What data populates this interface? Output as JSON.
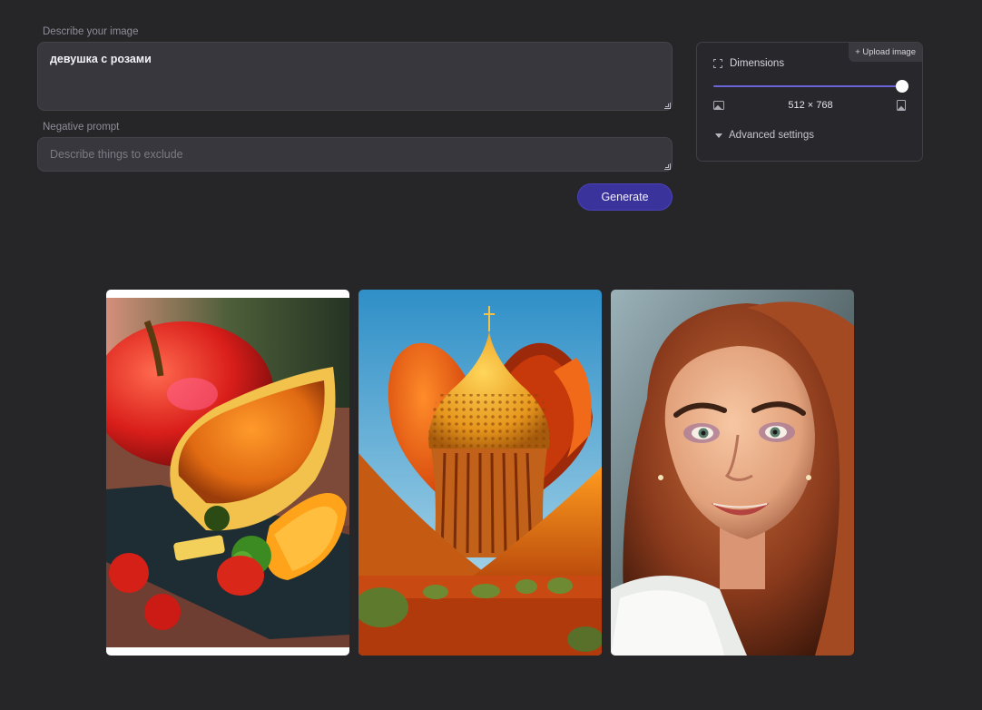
{
  "prompt": {
    "label": "Describe your image",
    "value": "девушка с розами"
  },
  "negative_prompt": {
    "label": "Negative prompt",
    "placeholder": "Describe things to exclude"
  },
  "actions": {
    "generate_label": "Generate"
  },
  "settings": {
    "upload_label": "+ Upload image",
    "dimensions_label": "Dimensions",
    "dimensions_value": "512 × 768",
    "slider_level": 1.0,
    "advanced_label": "Advanced settings"
  },
  "gallery": {
    "images": [
      {
        "subject": "fruit still life with apple, orange and tomatoes"
      },
      {
        "subject": "surreal desert dome with heart-shaped arches"
      },
      {
        "subject": "portrait of a woman with auburn hair"
      }
    ]
  },
  "colors": {
    "background": "#262528",
    "accent": "#3b339c",
    "slider": "#6b64d6"
  }
}
